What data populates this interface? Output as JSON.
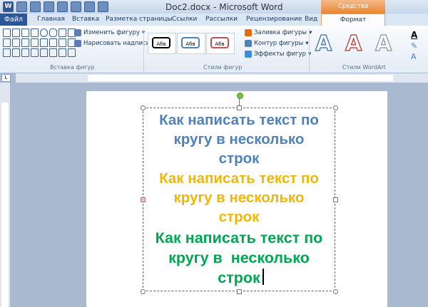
{
  "window": {
    "title": "Doc2.docx - Microsoft Word",
    "app_letter": "W"
  },
  "tabs": {
    "file": "Файл",
    "items": [
      "Главная",
      "Вставка",
      "Разметка страницы",
      "Ссылки",
      "Рассылки",
      "Рецензирование",
      "Вид"
    ],
    "tools_group": "Средства рисования",
    "format": "Формат"
  },
  "ribbon": {
    "insert_shapes": {
      "label": "Вставка фигур",
      "edit_shape": "Изменить фигуру",
      "draw_textbox": "Нарисовать надпись"
    },
    "shape_styles": {
      "label": "Стили фигур",
      "preview_text": "Абв",
      "presets": [
        {
          "text": "Абв",
          "color": "#000000"
        },
        {
          "text": "Абв",
          "color": "#4f81bd"
        },
        {
          "text": "Абв",
          "color": "#c0504d"
        }
      ],
      "fill": "Заливка фигуры",
      "outline": "Контур фигуры",
      "effects": "Эффекты фигур"
    },
    "wordart": {
      "label": "Стили WordArt",
      "letters": [
        "A",
        "A",
        "A"
      ]
    },
    "ruler_label": "L"
  },
  "document": {
    "paragraphs": [
      {
        "lines": [
          "Как написать текст по",
          "кругу в несколько",
          "строк"
        ],
        "color": "#4f81bd"
      },
      {
        "lines": [
          "Как написать текст по",
          "кругу в несколько",
          "строк"
        ],
        "color": "#f2b705"
      },
      {
        "lines": [
          "Как написать текст по",
          "кругу в  несколько",
          "строк"
        ],
        "color": "#00a651"
      }
    ]
  }
}
